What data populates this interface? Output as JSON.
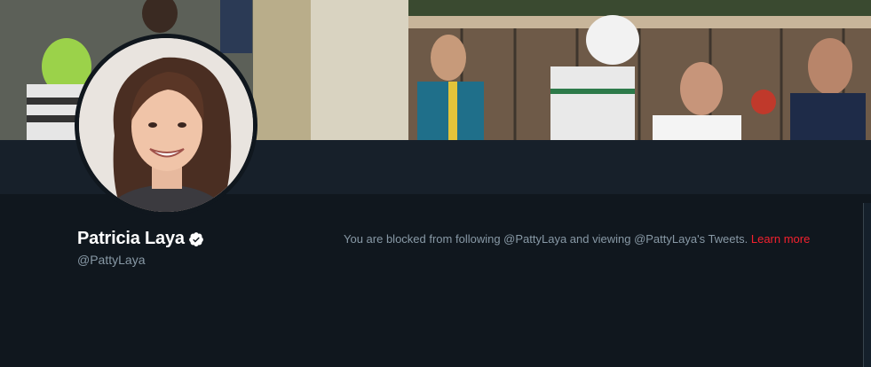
{
  "profile": {
    "display_name": "Patricia Laya",
    "handle": "@PattyLaya",
    "verified_icon": "verified-badge-icon"
  },
  "notice": {
    "text": "You are blocked from following @PattyLaya and viewing @PattyLaya's Tweets. ",
    "link_label": "Learn more"
  },
  "colors": {
    "background": "#10171e",
    "navbar": "#17202a",
    "name": "#ffffff",
    "secondary_text": "#8899a6",
    "link": "#f4212e"
  }
}
